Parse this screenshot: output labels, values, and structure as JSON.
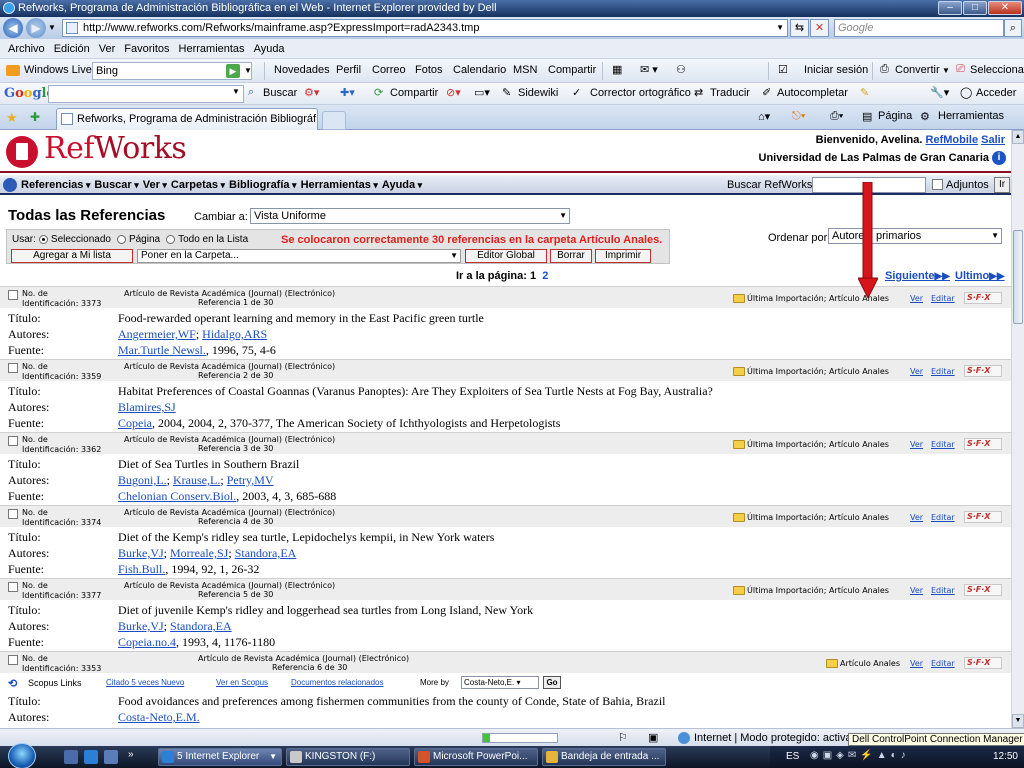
{
  "window": {
    "title": "Refworks, Programa de Administración Bibliográfica en el Web - Internet Explorer provided by Dell",
    "url": "http://www.refworks.com/Refworks/mainframe.asp?ExpressImport=radA2343.tmp",
    "search_placeholder": "Google",
    "tab_title": "Refworks, Programa de Administración Bibliográf...",
    "controls": {
      "minimize": "–",
      "maximize": "□",
      "close": "✕"
    }
  },
  "menubar": [
    "Archivo",
    "Edición",
    "Ver",
    "Favoritos",
    "Herramientas",
    "Ayuda"
  ],
  "windows_live_toolbar": {
    "brand": "Windows Live",
    "search_value": "Bing",
    "items": [
      "Novedades",
      "Perfil",
      "Correo",
      "Fotos",
      "Calendario",
      "MSN",
      "Compartir"
    ],
    "signin": "Iniciar sesión",
    "convert": "Convertir",
    "select": "Seleccionar"
  },
  "google_toolbar": {
    "logo": "Google",
    "items": [
      "Buscar",
      "Compartir",
      "Sidewiki",
      "Corrector ortográfico",
      "Traducir",
      "Autocompletar"
    ],
    "signin": "Acceder"
  },
  "command_bar": {
    "page": "Página",
    "tools": "Herramientas"
  },
  "refworks": {
    "logo_ref": "Ref",
    "logo_works": "Works",
    "welcome_prefix": "Bienvenido, Avelina.",
    "refmobile": "RefMobile",
    "logout": "Salir",
    "university": "Universidad de Las Palmas de Gran Canaria",
    "info_glyph": "i",
    "nav_menus": [
      "Referencias",
      "Buscar",
      "Ver",
      "Carpetas",
      "Bibliografía",
      "Herramientas",
      "Ayuda"
    ],
    "search_label": "Buscar RefWorks",
    "attachments_label": "Adjuntos",
    "ir_button": "Ir",
    "heading": "Todas las Referencias",
    "change_label": "Cambiar a:",
    "view_value": "Vista Uniforme",
    "use": {
      "label": "Usar:",
      "options": [
        "Seleccionado",
        "Página",
        "Todo en la Lista"
      ],
      "selected": "Seleccionado"
    },
    "status_message": "Se colocaron correctamente 30 referencias en la carpeta Artículo Anales.",
    "buttons": {
      "add_to_list": "Agregar a Mi lista",
      "folder_placeholder": "Poner en la Carpeta...",
      "global_editor": "Editor Global",
      "delete": "Borrar",
      "print": "Imprimir"
    },
    "order_label": "Ordenar  por",
    "order_value": "Autores, primarios",
    "pager": {
      "label": "Ir a la página:",
      "current": "1",
      "other": "2",
      "next": "Siguiente",
      "last": "Ultimo"
    },
    "field_labels": {
      "title": "Título:",
      "authors": "Autores:",
      "source": "Fuente:"
    },
    "ref_common": {
      "id_prefix": "No. de",
      "id_prefix2": "Identificación:",
      "ver": "Ver",
      "editar": "Editar",
      "sfx": "S·F·X",
      "last_import": "Última Importación;",
      "folder_name": "Artículo Anales"
    },
    "references": [
      {
        "id": "3373",
        "type": "Artículo de Revista Académica (Journal) (Electrónico)",
        "refnum": "Referencia 1 de 30",
        "title": "Food-rewarded operant learning and memory in the East Pacific green turtle",
        "authors": [
          "Angermeier,WF",
          "Hidalgo,ARS"
        ],
        "source_link": "Mar.Turtle Newsl.",
        "source_rest": ", 1996, 75, 4-6"
      },
      {
        "id": "3359",
        "type": "Artículo de Revista Académica (Journal) (Electrónico)",
        "refnum": "Referencia 2 de 30",
        "title": "Habitat Preferences of Coastal Goannas (Varanus Panoptes): Are They Exploiters of Sea Turtle Nests at Fog Bay, Australia?",
        "authors": [
          "Blamires,SJ"
        ],
        "source_link": "Copeia",
        "source_rest": ", 2004, 2004, 2, 370-377, The American Society of Ichthyologists and Herpetologists"
      },
      {
        "id": "3362",
        "type": "Artículo de Revista Académica (Journal) (Electrónico)",
        "refnum": "Referencia 3 de 30",
        "title": "Diet of Sea Turtles in Southern Brazil",
        "authors": [
          "Bugoni,L.",
          "Krause,L.",
          "Petry,MV"
        ],
        "source_link": "Chelonian Conserv.Biol.",
        "source_rest": ", 2003, 4, 3, 685-688"
      },
      {
        "id": "3374",
        "type": "Artículo de Revista Académica (Journal) (Electrónico)",
        "refnum": "Referencia 4 de 30",
        "title": "Diet of the Kemp's ridley sea turtle, Lepidochelys kempii, in New York waters",
        "authors": [
          "Burke,VJ",
          "Morreale,SJ",
          "Standora,EA"
        ],
        "source_link": "Fish.Bull.",
        "source_rest": ", 1994, 92, 1, 26-32"
      },
      {
        "id": "3377",
        "type": "Artículo de Revista Académica (Journal) (Electrónico)",
        "refnum": "Referencia 5 de 30",
        "title": "Diet of juvenile Kemp's ridley and loggerhead sea turtles from Long Island, New York",
        "authors": [
          "Burke,VJ",
          "Standora,EA"
        ],
        "source_link": "Copeia.no.4",
        "source_rest": ", 1993, 4, 1176-1180"
      },
      {
        "id": "3353",
        "type": "Artículo de Revista Académica (Journal) (Electrónico)",
        "refnum": "Referencia 6 de 30",
        "title": "Food avoidances and preferences among fishermen communities from the county of Conde, State of Bahia, Brazil",
        "authors": [
          "Costa-Neto,E.M."
        ],
        "source_link": "",
        "source_rest": ""
      }
    ],
    "scopus": {
      "label": "Scopus Links",
      "cited": "Citado 5 veces Nuevo",
      "view": "Ver en Scopus",
      "related": "Documentos relacionados",
      "more_by": "More by",
      "author_value": "Costa-Neto,E.",
      "go": "Go"
    }
  },
  "statusbar": {
    "zone": "Internet | Modo protegido: activado",
    "tooltip": "Dell ControlPoint Connection Manager",
    "progress": 0.1
  },
  "taskbar": {
    "tasks": [
      "5 Internet Explorer",
      "KINGSTON (F:)",
      "Microsoft PowerPoi...",
      "Bandeja de entrada ..."
    ],
    "language": "ES",
    "time": "12:50"
  }
}
